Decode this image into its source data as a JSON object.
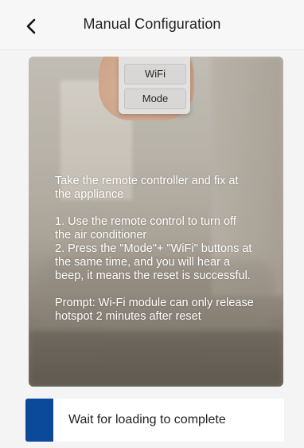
{
  "header": {
    "title": "Manual Configuration",
    "back_icon": "chevron-left-icon"
  },
  "illustration": {
    "remote_buttons": {
      "wifi": "WiFi",
      "mode": "Mode"
    }
  },
  "instructions": {
    "intro": "Take the remote controller and fix at the appliance",
    "step1": "1. Use the remote control to turn off the air conditioner",
    "step2": "2. Press the \"Mode\"+ \"WiFi\" buttons at the same time, and you will hear a beep, it means the reset is successful.",
    "prompt": "Prompt: Wi-Fi module can only release hotspot 2 minutes after reset"
  },
  "status": {
    "text": "Wait for loading to complete",
    "accent_color": "#0b4a9a"
  }
}
